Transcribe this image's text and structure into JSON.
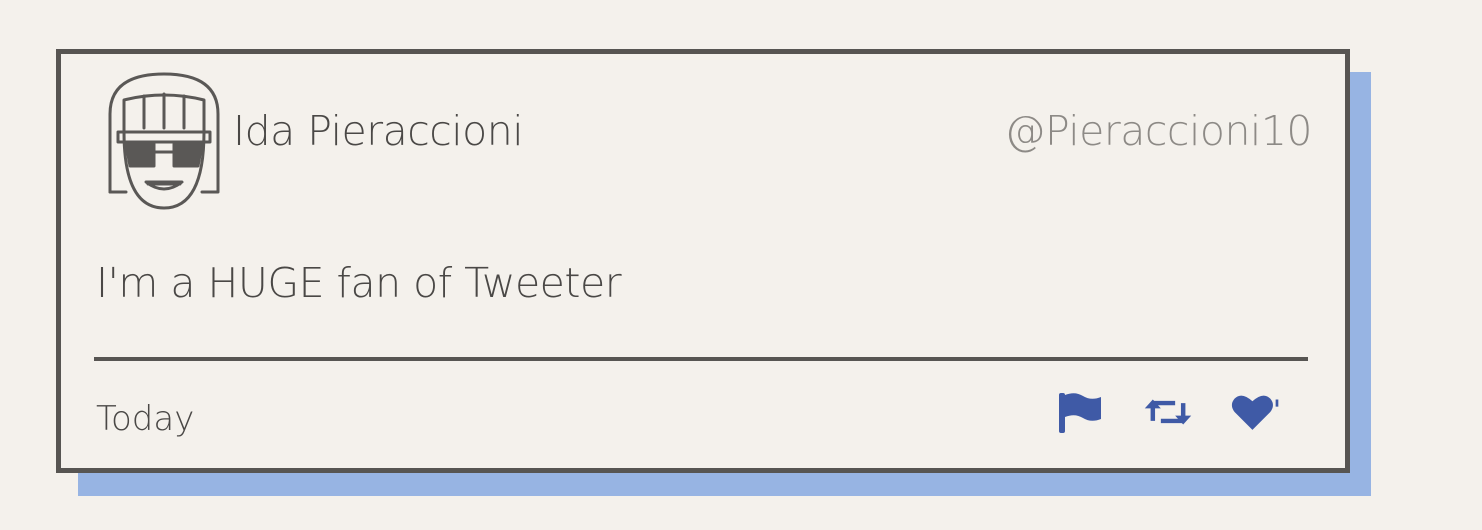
{
  "tweet": {
    "author_name": "Ida Pieraccioni",
    "author_handle": "@Pieraccioni10",
    "text": "I'm a HUGE fan of Tweeter",
    "timestamp": "Today"
  },
  "actions": [
    {
      "icon": "flag-icon",
      "label": "Report"
    },
    {
      "icon": "retweet-icon",
      "label": "Retweet"
    },
    {
      "icon": "heart-icon",
      "label": "Like"
    }
  ],
  "colors": {
    "background": "#f4f1ec",
    "card_border": "#575552",
    "shadow": "#97b4e3",
    "icon_accent": "#3f5aa6",
    "text": "#4a4846",
    "handle_text": "#8d8a86"
  }
}
